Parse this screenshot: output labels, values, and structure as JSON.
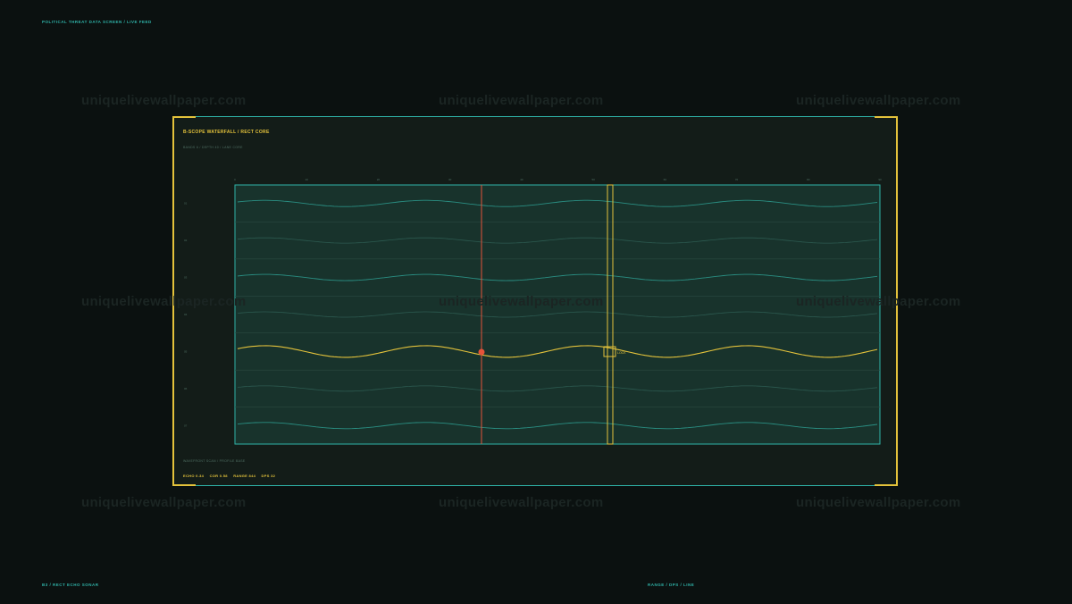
{
  "header": {
    "label": "POLITICAL THREAT DATA SCREEN / LIVE FEED"
  },
  "footer": {
    "left": "B3 / RECT ECHO SONAR",
    "right": "RANGE / DPS / LINE"
  },
  "watermark": {
    "text": "uniquelivewallpaper.com"
  },
  "panel": {
    "title": "B-SCOPE WATERFALL / RECT CORE",
    "subtitle": "BANDS 6 / DEPTH 40 / LANE CORE",
    "foot_note": "WAVEFRONT SCAN / PROFILE BASE",
    "stats": [
      "ECHO 0.34",
      "COR 0.58",
      "RANGE 844",
      "DPS 32"
    ]
  },
  "scope": {
    "marker_label": "LOCK",
    "top_ticks": [
      "0",
      "10",
      "20",
      "30",
      "40",
      "50",
      "60",
      "70",
      "80",
      "90"
    ],
    "row_labels": [
      "01",
      "02",
      "03",
      "04",
      "05",
      "06",
      "07"
    ]
  },
  "colors": {
    "background": "#0b1110",
    "panel": "#131c18",
    "accent_teal": "#2fb3a8",
    "accent_yellow": "#e3c23b",
    "accent_red": "#e5533a"
  },
  "icons": {
    "target": "crosshair-box-icon",
    "dot": "echo-dot-icon"
  }
}
